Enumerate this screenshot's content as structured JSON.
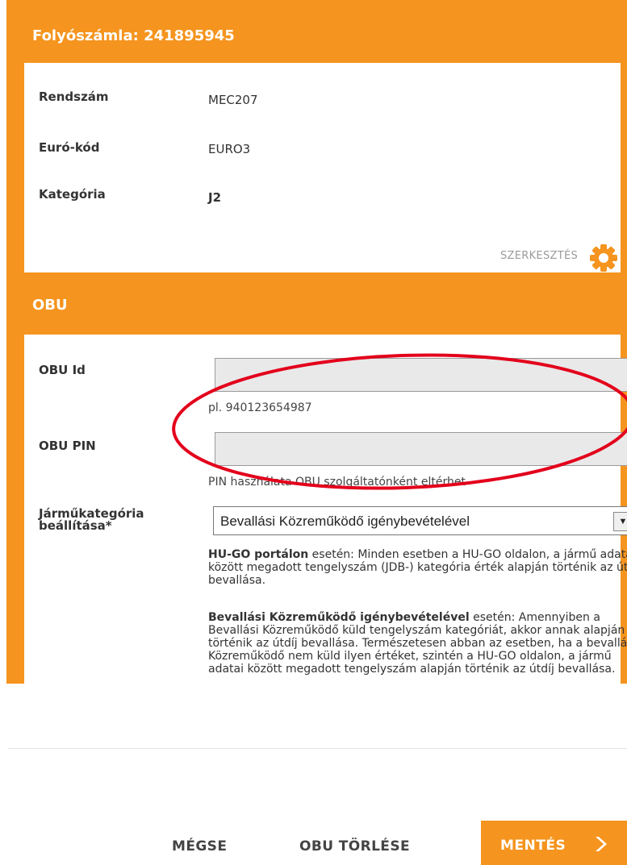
{
  "account": {
    "title": "Folyószámla: 241895945",
    "fields": [
      {
        "label": "Rendszám",
        "value": "MEC207"
      },
      {
        "label": "Euró-kód",
        "value": "EURO3"
      },
      {
        "label": "Kategória",
        "value": "J2"
      }
    ],
    "edit_label": "SZERKESZTÉS"
  },
  "obu": {
    "title": "OBU",
    "id_label": "OBU Id",
    "id_value": "",
    "id_hint": "pl. 940123654987",
    "pin_label": "OBU PIN",
    "pin_value": "",
    "pin_hint": "PIN használata OBU szolgáltatónként eltérhet",
    "category_label": "Járműkategória\nbeállítása*",
    "category_selected": "Bevallási Közreműködő igénybevételével",
    "para1_bold": "HU-GO portálon",
    "para1_text": " esetén: Minden esetben a HU-GO oldalon, a jármű adatai között megadott tengelyszám (JDB-) kategória érték alapján történik az útdíj bevallása.",
    "para2_bold": "Bevallási Közreműködő igénybevételével",
    "para2_text": " esetén: Amennyiben a Bevallási Közreműködő küld tengelyszám kategóriát, akkor annak alapján történik az útdíj bevallása. Természetesen abban az esetben, ha a bevallási Közreműködő nem küld ilyen értéket, szintén a HU-GO oldalon, a jármű adatai között megadott tengelyszám alapján történik az útdíj bevallása."
  },
  "actions": {
    "cancel": "MÉGSE",
    "delete": "OBU TÖRLÉSE",
    "save": "MENTÉS"
  },
  "colors": {
    "accent": "#f5941e",
    "annotation": "#e3001b"
  },
  "icons": {
    "edit": "gear-icon",
    "save": "chevron-right-icon",
    "select": "triangle-down-icon"
  }
}
